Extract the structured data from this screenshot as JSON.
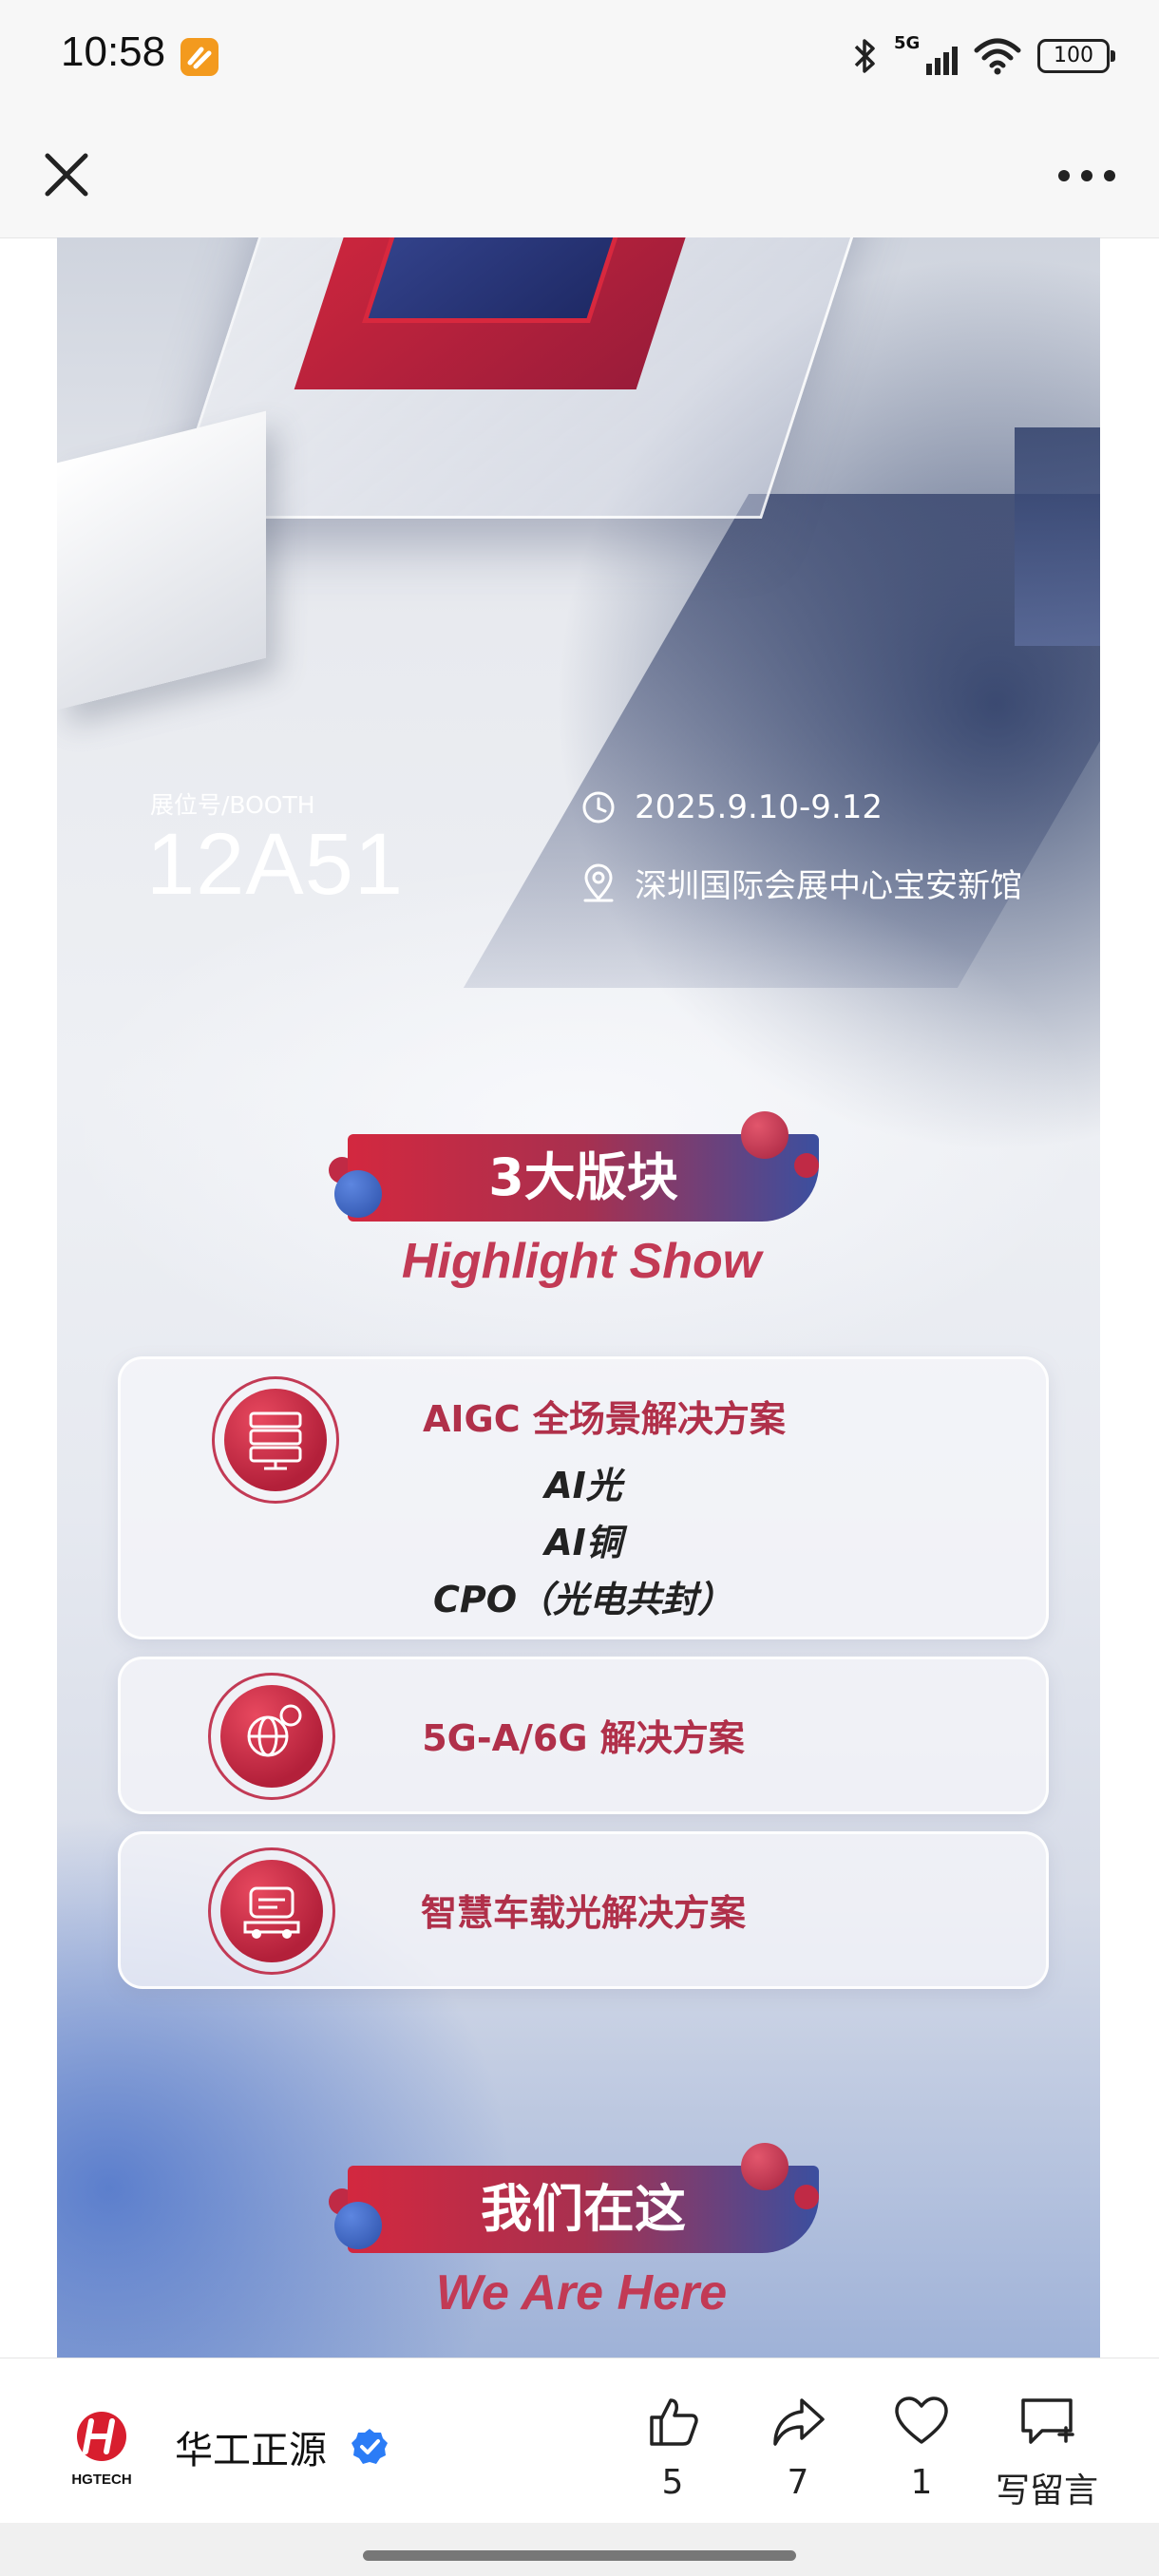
{
  "status_bar": {
    "time": "10:58",
    "network": "5G",
    "battery": "100"
  },
  "poster": {
    "booth_label": "展位号/BOOTH",
    "booth_number": "12A51",
    "date": "2025.9.10-9.12",
    "venue": "深圳国际会展中心宝安新馆",
    "section1": {
      "title": "3大版块",
      "subtitle": "Highlight Show"
    },
    "cards": [
      {
        "title": "AIGC 全场景解决方案",
        "items": [
          "AI光",
          "AI铜",
          "CPO（光电共封）"
        ]
      },
      {
        "title": "5G-A/6G 解决方案"
      },
      {
        "title": "智慧车载光解决方案"
      }
    ],
    "section2": {
      "title": "我们在这",
      "subtitle": "We Are Here"
    }
  },
  "bottom_bar": {
    "logo_text": "HGTECH",
    "account_name": "华工正源",
    "like_count": "5",
    "share_count": "7",
    "favorite_count": "1",
    "comment_label": "写留言"
  },
  "colors": {
    "brand_red": "#d3283f",
    "brand_blue": "#3b4f9f",
    "verified_blue": "#2b7cf6"
  }
}
